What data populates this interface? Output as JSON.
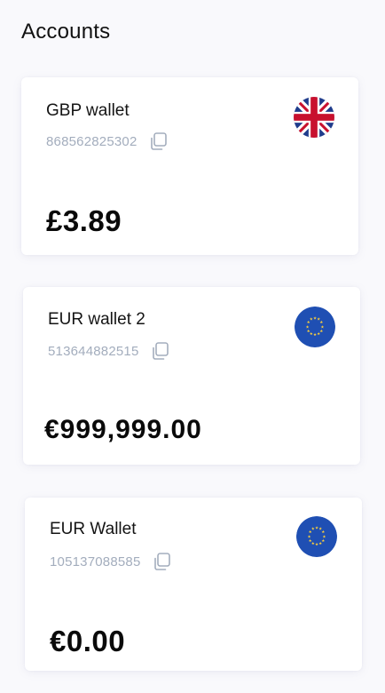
{
  "header": {
    "title": "Accounts"
  },
  "accounts": [
    {
      "name": "GBP wallet",
      "number": "868562825302",
      "balance": "£3.89",
      "flag_icon": "uk-flag-icon"
    },
    {
      "name": "EUR wallet 2",
      "number": "513644882515",
      "balance": "€999,999.00",
      "flag_icon": "eu-flag-icon"
    },
    {
      "name": "EUR Wallet",
      "number": "105137088585",
      "balance": "€0.00",
      "flag_icon": "eu-flag-icon"
    }
  ],
  "icons": {
    "copy": "copy-icon"
  },
  "colors": {
    "background": "#f9f9fc",
    "card": "#ffffff",
    "account_number": "#a3adbd",
    "eu_blue": "#1f4fb3",
    "eu_star": "#ffd23a",
    "uk_blue": "#1f3c8c",
    "uk_red": "#c8102e"
  }
}
